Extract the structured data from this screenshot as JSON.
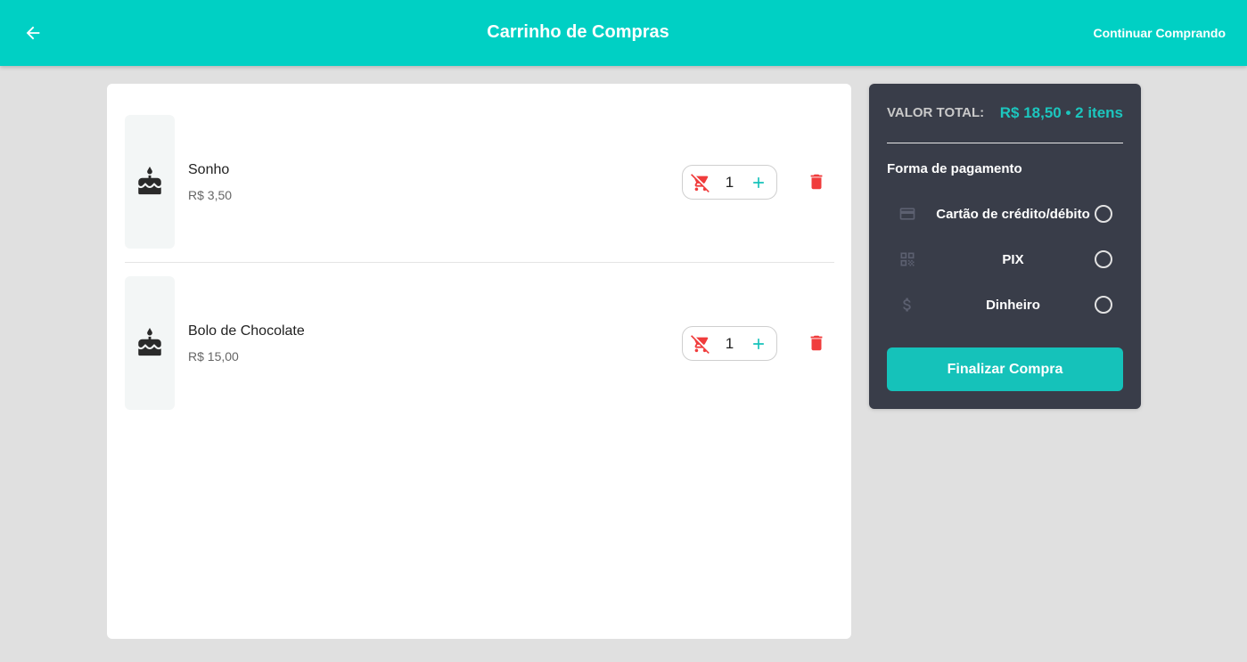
{
  "header": {
    "title": "Carrinho de Compras",
    "continue_label": "Continuar Comprando",
    "back_icon": "arrow-left-icon"
  },
  "cart": {
    "items": [
      {
        "name": "Sonho",
        "price": "R$ 3,50",
        "quantity": "1",
        "icon": "cake-icon"
      },
      {
        "name": "Bolo de Chocolate",
        "price": "R$ 15,00",
        "quantity": "1",
        "icon": "cake-icon"
      }
    ]
  },
  "summary": {
    "total_label": "VALOR TOTAL:",
    "total_value": "R$ 18,50 • 2 itens",
    "payment_title": "Forma de pagamento",
    "options": [
      {
        "label": "Cartão de crédito/débito",
        "icon": "credit-card-icon",
        "selected": false
      },
      {
        "label": "PIX",
        "icon": "qr-code-icon",
        "selected": false
      },
      {
        "label": "Dinheiro",
        "icon": "dollar-icon",
        "selected": false
      }
    ],
    "finish_label": "Finalizar Compra"
  },
  "colors": {
    "primary": "#00d0c4",
    "accent": "#15c2ba",
    "danger": "#f03c3c",
    "summary_bg": "#393d49",
    "page_bg": "#e0e0e0"
  }
}
